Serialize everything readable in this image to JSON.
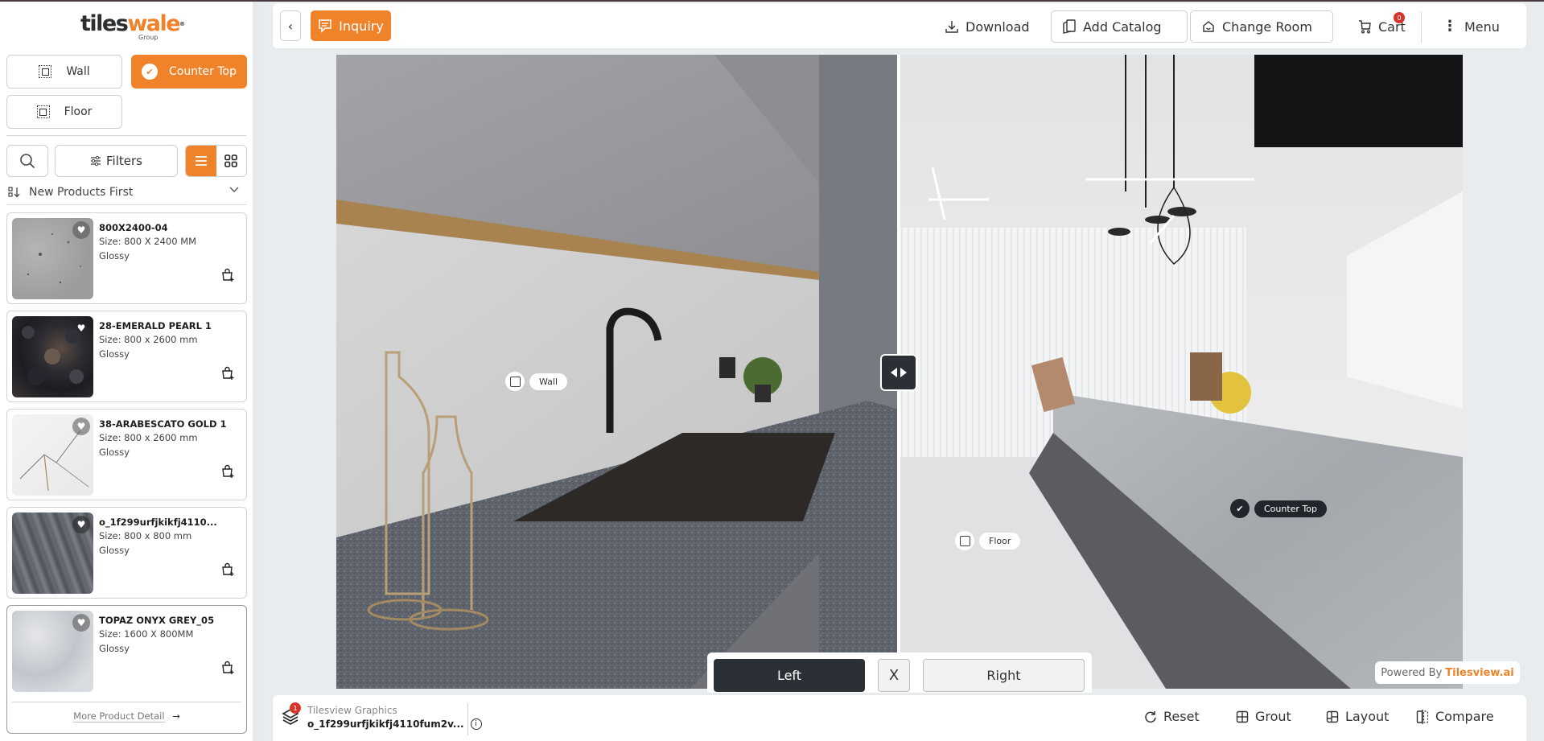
{
  "brand": {
    "logo_part1": "tiles",
    "logo_part2": "wale",
    "logo_sub": "Group",
    "registered": "®",
    "accent_color": "#f0832a"
  },
  "surfaces": [
    {
      "label": "Wall",
      "active": false,
      "icon": "select-area-icon"
    },
    {
      "label": "Counter Top",
      "active": true,
      "icon": "check-badge-icon"
    },
    {
      "label": "Floor",
      "active": false,
      "icon": "select-area-icon"
    }
  ],
  "toolbar": {
    "filters_label": "Filters",
    "sort_label": "New Products First"
  },
  "products": [
    {
      "name": "800X2400-04",
      "size": "Size: 800 X 2400 MM",
      "finish": "Glossy"
    },
    {
      "name": "28-EMERALD PEARL 1",
      "size": "Size: 800 x 2600 mm",
      "finish": "Glossy"
    },
    {
      "name": "38-ARABESCATO GOLD 1",
      "size": "Size: 800 x 2600 mm",
      "finish": "Glossy"
    },
    {
      "name": "o_1f299urfjkikfj4110...",
      "size": "Size: 800 x 800 mm",
      "finish": "Glossy"
    },
    {
      "name": "TOPAZ ONYX GREY_05",
      "size": "Size: 1600 X 800MM",
      "finish": "Glossy",
      "selected": true,
      "more_label": "More Product Detail"
    }
  ],
  "topbar": {
    "back_icon": "chevron-left-icon",
    "inquiry_label": "Inquiry",
    "download_label": "Download",
    "add_catalog_label": "Add Catalog",
    "change_room_label": "Change Room",
    "cart_label": "Cart",
    "cart_count": "0",
    "menu_label": "Menu"
  },
  "hotspots": {
    "wall": "Wall",
    "floor": "Floor",
    "counter_top": "Counter Top"
  },
  "compare": {
    "left_label": "Left",
    "close_label": "X",
    "right_label": "Right"
  },
  "powered": {
    "prefix": "Powered By",
    "brand": "Tilesview.ai"
  },
  "bottombar": {
    "layers_count": "1",
    "brand": "Tilesview Graphics",
    "product_name": "o_1f299urfjkikfj4110fum2v...",
    "info_icon": "i",
    "reset_label": "Reset",
    "grout_label": "Grout",
    "layout_label": "Layout",
    "compare_label": "Compare"
  }
}
